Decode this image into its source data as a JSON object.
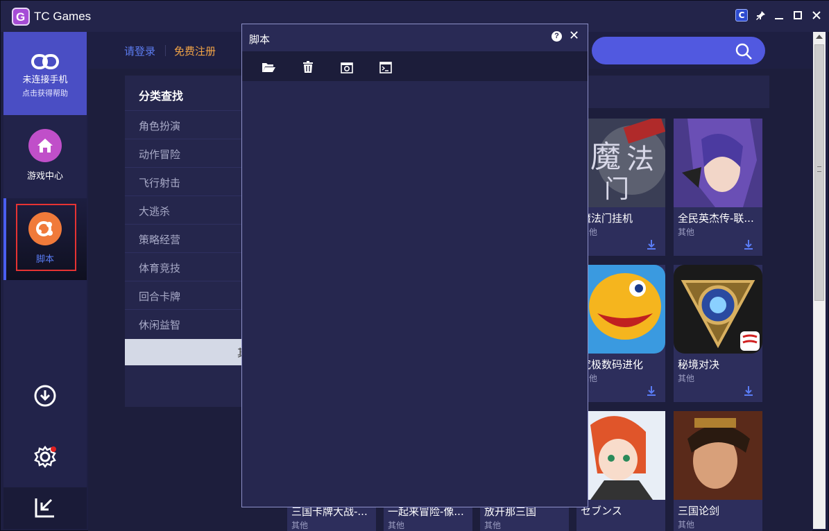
{
  "app": {
    "title": "TC Games",
    "logo_letter": "G"
  },
  "window_controls": {
    "c": "C",
    "pin": "✈",
    "minimize": "—",
    "maximize": "□",
    "close": "✕"
  },
  "sidebar": {
    "connect_title": "未连接手机",
    "connect_subtitle": "点击获得帮助",
    "items": [
      {
        "label": "游戏中心",
        "icon": "home-icon"
      },
      {
        "label": "脚本",
        "icon": "script-icon",
        "active": true
      }
    ],
    "bottom_icons": [
      "download-icon",
      "gear-icon",
      "import-icon"
    ]
  },
  "header": {
    "login": "请登录",
    "register": "免费注册",
    "search_icon": "search-icon"
  },
  "categories": {
    "title": "分类查找",
    "items": [
      "角色扮演",
      "动作冒险",
      "飞行射击",
      "大逃杀",
      "策略经营",
      "体育竞技",
      "回合卡牌",
      "休闲益智"
    ],
    "selected_partial": "其"
  },
  "games": [
    {
      "name": "魔法门挂机",
      "tag": "其他"
    },
    {
      "name": "全民英杰传-联...",
      "tag": "其他"
    },
    {
      "name": "究极数码进化",
      "tag": "其他"
    },
    {
      "name": "秘境对决",
      "tag": "其他"
    },
    {
      "name": "セブンス",
      "tag": ""
    },
    {
      "name": "三国论剑",
      "tag": "其他"
    }
  ],
  "bottom_games": [
    {
      "name": "三国卡牌大战-...",
      "tag": "其他"
    },
    {
      "name": "一起来冒险-像...",
      "tag": "其他"
    },
    {
      "name": "放开那三国",
      "tag": "其他"
    }
  ],
  "dialog": {
    "title": "脚本",
    "help": "?",
    "close": "✕",
    "tools": [
      "open-folder-icon",
      "delete-icon",
      "screenshot-icon",
      "terminal-icon"
    ]
  },
  "colors": {
    "accent": "#4a4ec4",
    "orange": "#f2a447",
    "link": "#5c7cf0",
    "highlight": "#e63333"
  }
}
